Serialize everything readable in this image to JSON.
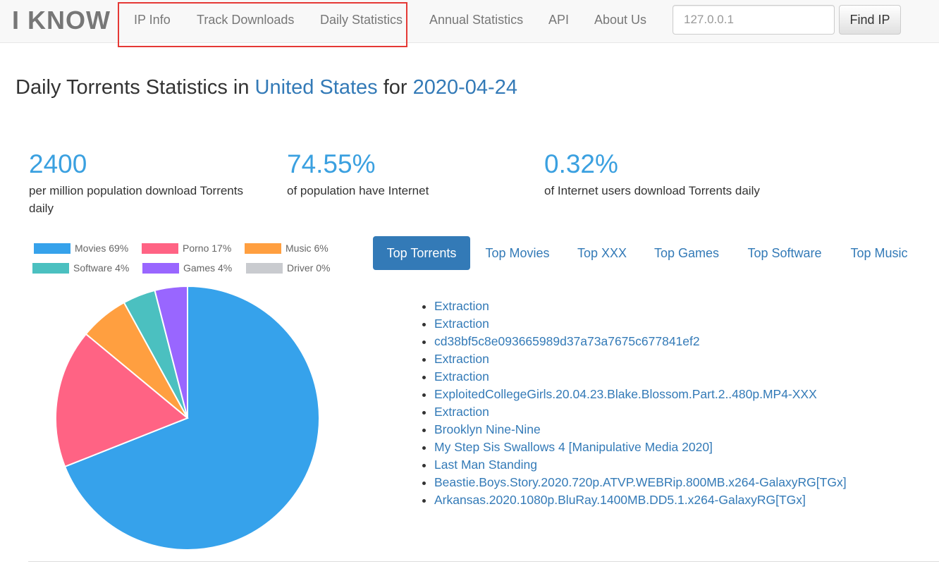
{
  "brand": "I KNOW",
  "nav": {
    "items": [
      {
        "label": "IP Info"
      },
      {
        "label": "Track Downloads"
      },
      {
        "label": "Daily Statistics"
      },
      {
        "label": "Annual Statistics"
      },
      {
        "label": "API"
      },
      {
        "label": "About Us"
      }
    ],
    "search_placeholder": "127.0.0.1",
    "find_label": "Find IP"
  },
  "title": {
    "prefix": "Daily Torrents Statistics in ",
    "country": "United States",
    "middle": " for ",
    "date": "2020-04-24"
  },
  "stats": [
    {
      "value": "2400",
      "label": "per million population download Torrents daily"
    },
    {
      "value": "74.55%",
      "label": "of population have Internet"
    },
    {
      "value": "0.32%",
      "label": "of Internet users download Torrents daily"
    }
  ],
  "chart_data": {
    "type": "pie",
    "labels": [
      "Movies",
      "Porno",
      "Music",
      "Software",
      "Games",
      "Driver"
    ],
    "values": [
      69,
      17,
      6,
      4,
      4,
      0
    ],
    "legend": [
      "Movies 69%",
      "Porno 17%",
      "Music 6%",
      "Software 4%",
      "Games 4%",
      "Driver 0%"
    ],
    "colors": [
      "#36a2eb",
      "#ff6384",
      "#ff9f40",
      "#4bc0c0",
      "#9966ff",
      "#c9cbcf"
    ],
    "legend_position": "top"
  },
  "tabs": [
    {
      "label": "Top Torrents",
      "active": true
    },
    {
      "label": "Top Movies"
    },
    {
      "label": "Top XXX"
    },
    {
      "label": "Top Games"
    },
    {
      "label": "Top Software"
    },
    {
      "label": "Top Music"
    }
  ],
  "torrents": [
    "Extraction",
    "Extraction",
    "cd38bf5c8e093665989d37a73a7675c677841ef2",
    "Extraction",
    "Extraction",
    "ExploitedCollegeGirls.20.04.23.Blake.Blossom.Part.2..480p.MP4-XXX",
    "Extraction",
    "Brooklyn Nine-Nine",
    "My Step Sis Swallows 4 [Manipulative Media 2020]",
    "Last Man Standing",
    "Beastie.Boys.Story.2020.720p.ATVP.WEBRip.800MB.x264-GalaxyRG[TGx]",
    "Arkansas.2020.1080p.BluRay.1400MB.DD5.1.x264-GalaxyRG[TGx]"
  ]
}
